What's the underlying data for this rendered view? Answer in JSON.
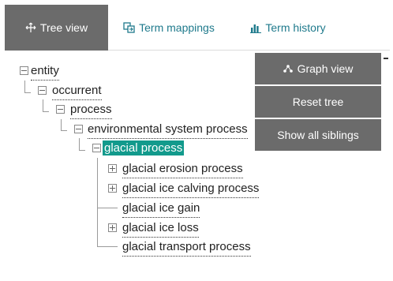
{
  "tabs": {
    "tree_view": "Tree view",
    "term_mappings": "Term mappings",
    "term_history": "Term history"
  },
  "tree": {
    "entity": "entity",
    "occurrent": "occurrent",
    "process": "process",
    "environmental_system_process": "environmental system process",
    "selected": "glacial process",
    "children": [
      {
        "label": "glacial erosion process",
        "expandable": true
      },
      {
        "label": "glacial ice calving process",
        "expandable": true
      },
      {
        "label": "glacial ice gain",
        "expandable": false
      },
      {
        "label": "glacial ice loss",
        "expandable": true
      },
      {
        "label": "glacial transport process",
        "expandable": false
      }
    ]
  },
  "panel": {
    "graph_view": "Graph view",
    "reset_tree": "Reset tree",
    "show_all_siblings": "Show all siblings"
  },
  "colors": {
    "tab_active_bg": "#6b6b6b",
    "link": "#1f7a8c",
    "selected_bg": "#129a8c",
    "panel_bg": "#6b6b6b"
  },
  "icons": [
    "tree-view-icon",
    "term-mappings-icon",
    "term-history-icon",
    "graph-view-icon"
  ]
}
